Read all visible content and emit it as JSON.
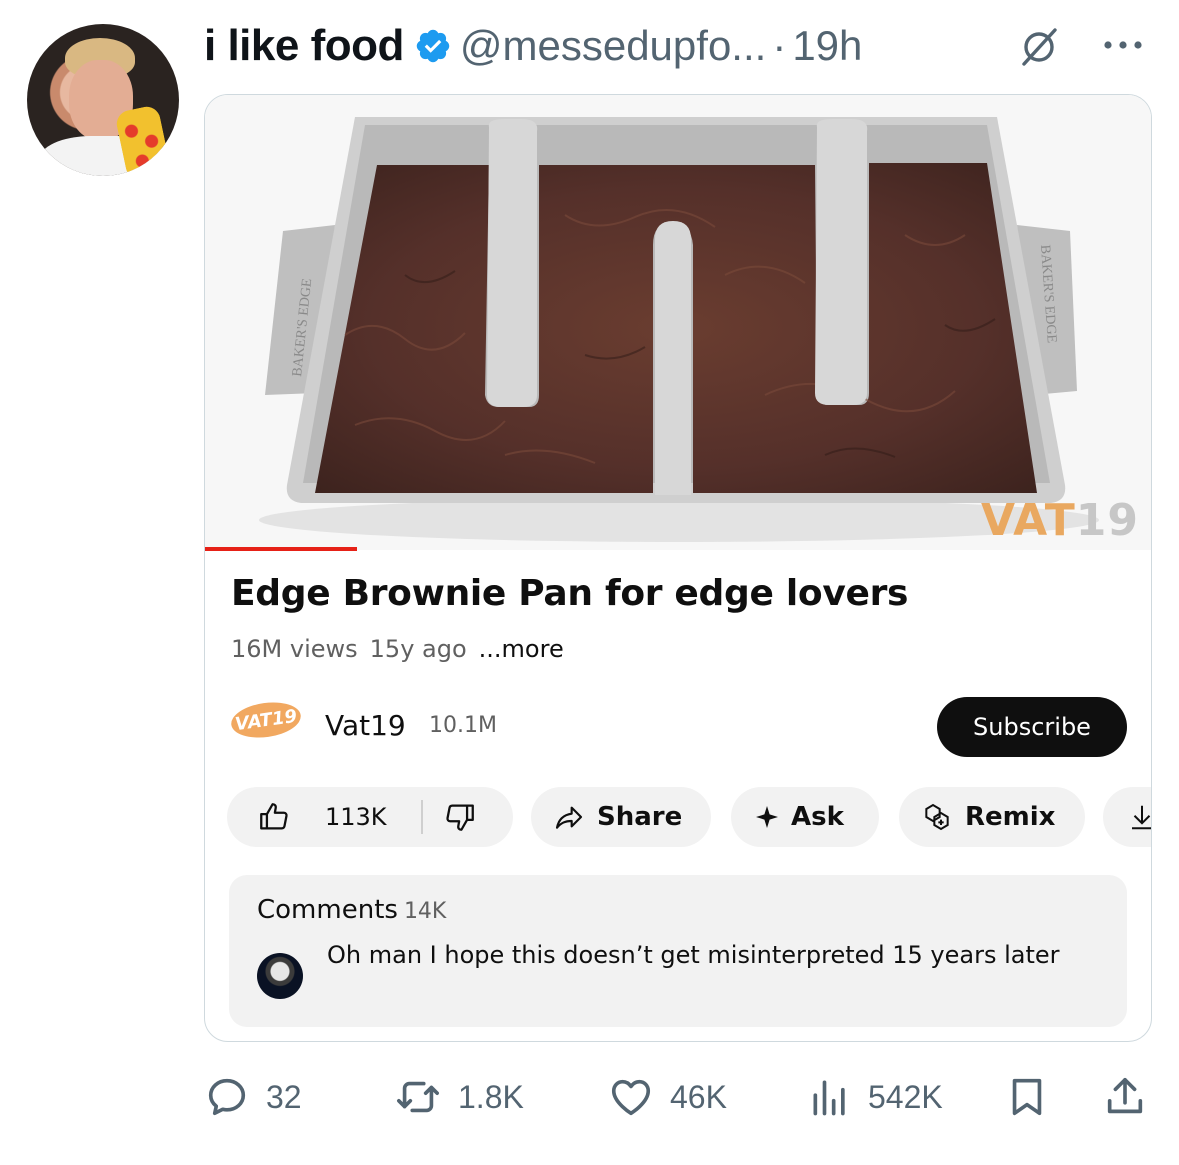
{
  "tweet": {
    "display_name": "i like food",
    "handle": "@messedupfo...",
    "separator": "·",
    "time": "19h"
  },
  "video": {
    "watermark_main": "VAT",
    "watermark_num": "19",
    "pan_label": "BAKER'S EDGE",
    "progress_fraction": 0.16,
    "title": "Edge Brownie Pan for edge lovers",
    "views": "16M views",
    "age": "15y ago",
    "more": "...more",
    "channel_logo": "VAT19",
    "channel_name": "Vat19",
    "channel_subs": "10.1M",
    "subscribe": "Subscribe",
    "likes": "113K",
    "share": "Share",
    "ask": "Ask",
    "remix": "Remix",
    "comments_label": "Comments",
    "comments_count": "14K",
    "top_comment": "Oh man I hope this doesn’t get misinterpreted 15 years later"
  },
  "footer": {
    "replies": "32",
    "reposts": "1.8K",
    "likes": "46K",
    "views": "542K"
  },
  "colors": {
    "verified": "#1d9bf0",
    "muted": "#536471",
    "progress": "#e62117",
    "brownie": "#5a3328",
    "pan": "#c9c9c9"
  },
  "icons": [
    "verified-badge-icon",
    "grok-icon",
    "more-icon",
    "like-icon",
    "dislike-icon",
    "share-arrow-icon",
    "sparkle-icon",
    "remix-icon",
    "download-icon",
    "reply-icon",
    "retweet-icon",
    "heart-icon",
    "views-icon",
    "bookmark-icon",
    "share-icon"
  ]
}
